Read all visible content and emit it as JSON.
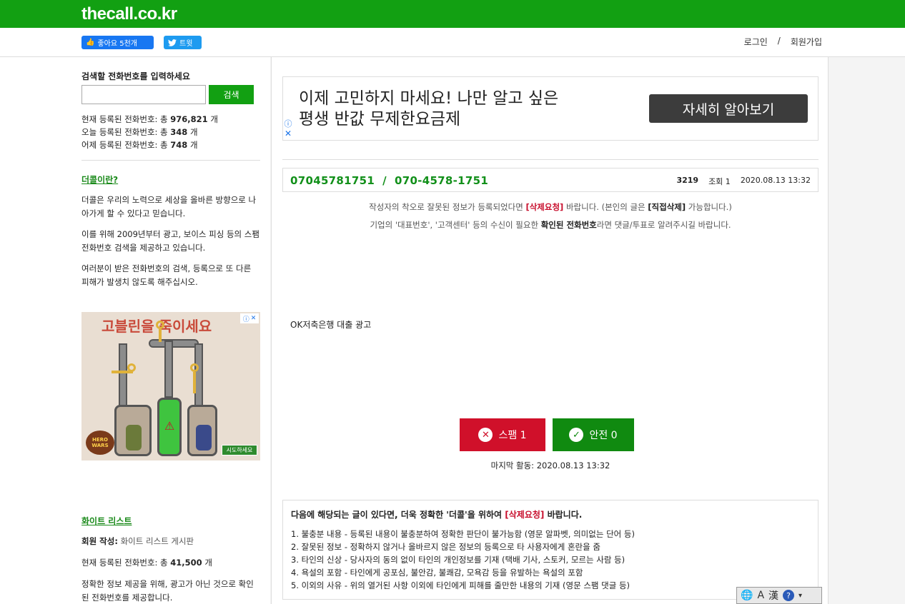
{
  "header": {
    "logo": "thecall.co.kr",
    "like_label": "좋아요 5천개",
    "tweet_label": "트윗",
    "login": "로그인",
    "separator": "/",
    "signup": "회원가입"
  },
  "sidebar": {
    "search_title": "검색할 전화번호를 입력하세요",
    "search_value": "",
    "search_button": "검색",
    "stats": [
      {
        "prefix": "현재 등록된 전화번호: 총 ",
        "value": "976,821",
        "suffix": " 개"
      },
      {
        "prefix": "오늘 등록된 전화번호: 총 ",
        "value": "348",
        "suffix": " 개"
      },
      {
        "prefix": "어제 등록된 전화번호: 총 ",
        "value": "748",
        "suffix": " 개"
      }
    ],
    "about_link": "더콜이란?",
    "about_paragraphs": [
      "더콜은 우리의 노력으로 세상을 올바른 방향으로 나아가게 할 수 있다고 믿습니다.",
      "이를 위해 2009년부터 광고, 보이스 피싱 등의 스팸 전화번호 검색을 제공하고 있습니다.",
      "여러분이 받은 전화번호의 검색, 등록으로 또 다른 피해가 발생치 않도록 해주십시오."
    ],
    "game_ad": {
      "title": "고블린을 죽이세요",
      "cta": "시도하세요",
      "brand": "HERO WARS"
    },
    "whitelist_link": "화이트 리스트",
    "whitelist_member_label": "회원 작성:",
    "whitelist_member_value": "화이트 리스트 게시판",
    "whitelist_count_prefix": "현재 등록된 전화번호: 총 ",
    "whitelist_count_value": "41,500",
    "whitelist_count_suffix": " 개",
    "whitelist_desc": "정확한 정보 제공을 위해, 광고가 아닌 것으로 확인된 전화번호를 제공합니다."
  },
  "main": {
    "ad_text_line1": "이제 고민하지 마세요! 나만 알고 싶은",
    "ad_text_line2": "평생 반값 무제한요금제",
    "ad_cta": "자세히 알아보기",
    "phone_title": "07045781751  /  070-4578-1751",
    "post_id": "3219",
    "views": "조회 1",
    "date": "2020.08.13 13:32",
    "notice1": {
      "a": "작성자의 착오로 잘못된 정보가 등록되었다면 ",
      "red": "[삭제요청]",
      "b": " 바랍니다. (본인의 글은 ",
      "bold": "[직접삭제]",
      "c": " 가능합니다.)"
    },
    "notice2": {
      "a": "기업의 '대표번호', '고객센터' 등의 수신이 필요한 ",
      "bold": "확인된 전화번호",
      "b": "라면 댓글/투표로 알려주시길 바랍니다."
    },
    "post_body": "OK저축은행 대출 광고",
    "spam_label": "스팸 1",
    "safe_label": "안전 0",
    "last_active": "마지막 활동: 2020.08.13 13:32",
    "rules_title_a": "다음에 해당되는 글이 있다면, 더욱 정확한 '더콜'을 위하여 ",
    "rules_title_red": "[삭제요청]",
    "rules_title_b": " 바랍니다.",
    "rules": [
      "1. 불충분 내용 - 등록된 내용이 불충분하여 정확한 판단이 불가능함 (영문 알파벳, 의미없는 단어 등)",
      "2. 잘못된 정보 - 정확하지 않거나 올바르지 않은 정보의 등록으로 타 사용자에게 혼란을 줌",
      "3. 타인의 신상 - 당사자의 동의 없이 타인의 개인정보를 기재 (택배 기사, 스토커, 모르는 사람 등)",
      "4. 욕설의 포함 - 타인에게 공포심, 불안감, 불쾌감, 모욕감 등을 유발하는 욕설의 포함",
      "5. 이외의 사유 - 위의 열거된 사항 이외에 타인에게 피해를 줄만한 내용의 기재 (영문 스팸 댓글 등)"
    ]
  },
  "ime": {
    "a": "A",
    "han": "漢",
    "help": "?"
  }
}
